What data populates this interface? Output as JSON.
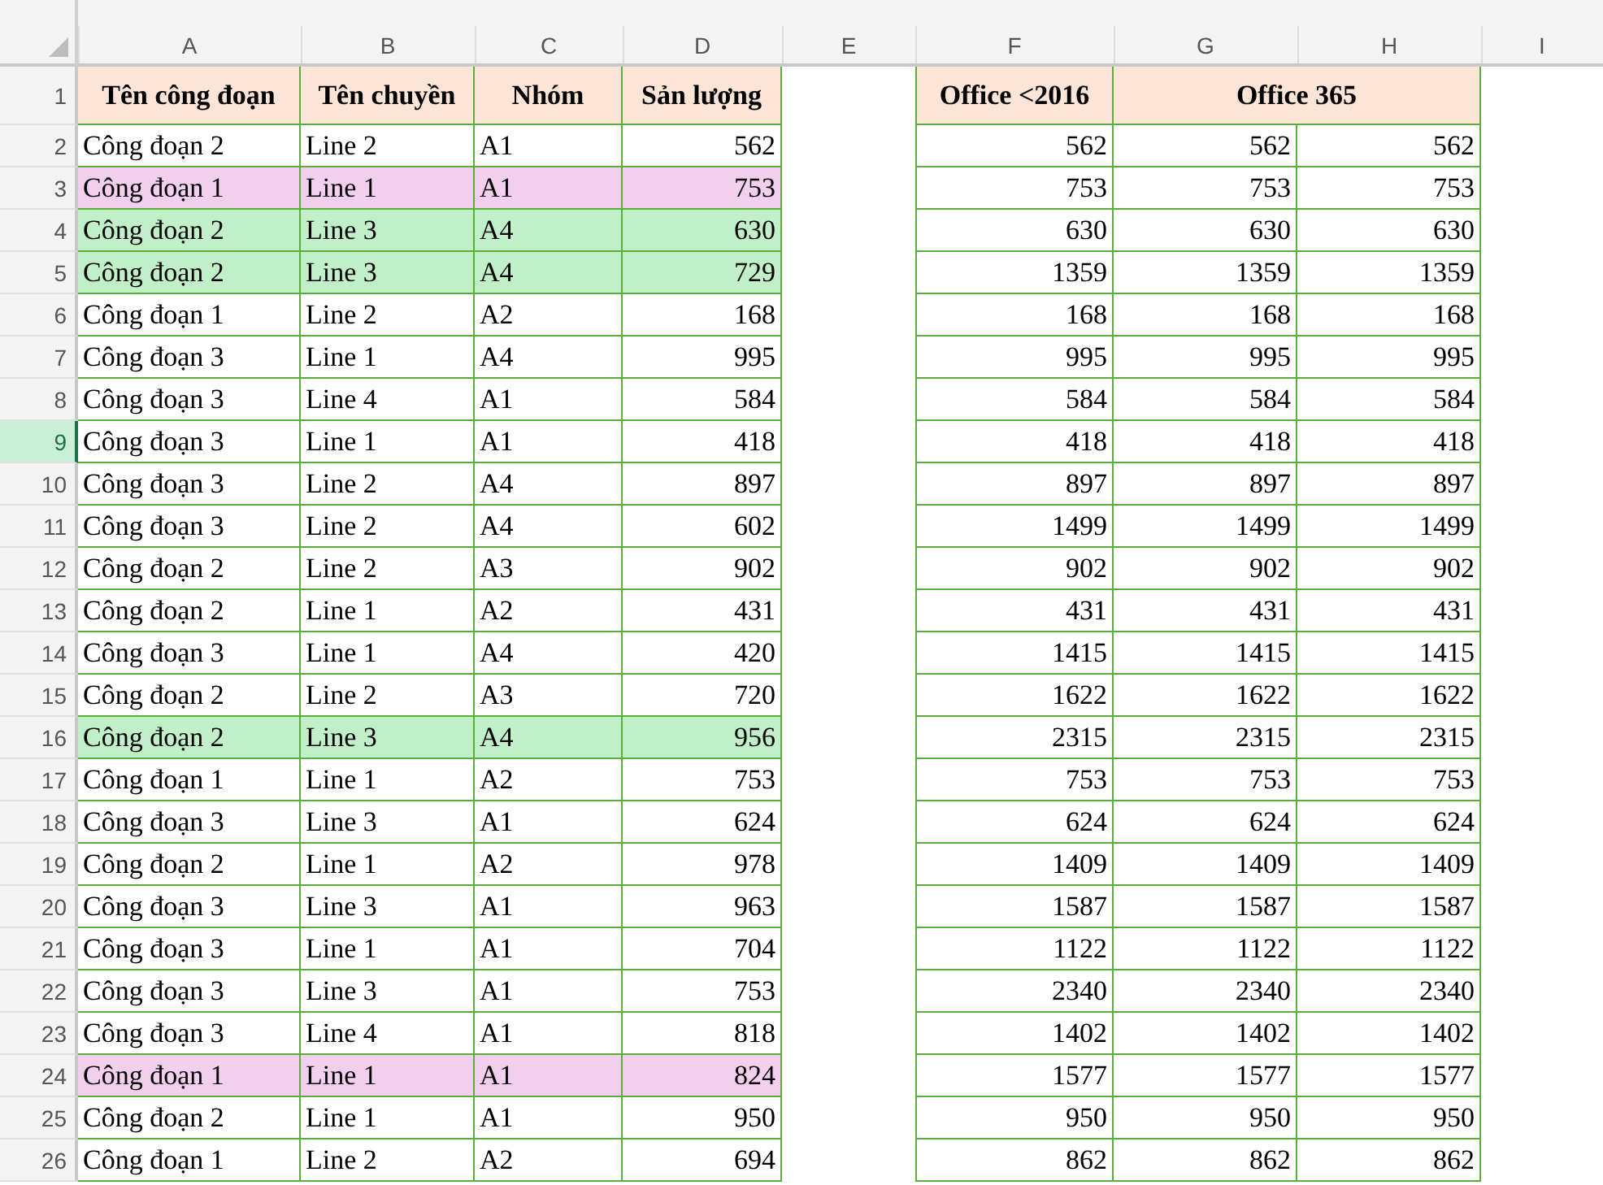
{
  "columns": [
    {
      "letter": "A"
    },
    {
      "letter": "B"
    },
    {
      "letter": "C"
    },
    {
      "letter": "D"
    },
    {
      "letter": "E"
    },
    {
      "letter": "F"
    },
    {
      "letter": "G"
    },
    {
      "letter": "H"
    },
    {
      "letter": "I"
    }
  ],
  "header_row": {
    "number": "1",
    "headers": [
      "Tên công đoạn",
      "Tên chuyền",
      "Nhóm",
      "Sản lượng"
    ],
    "office_old": "Office <2016",
    "office_365": "Office 365"
  },
  "rows": [
    {
      "number": "2",
      "selected": false,
      "color": "#ffffff",
      "cells": [
        "Công đoạn 2",
        "Line 2",
        "A1",
        "562"
      ],
      "results": [
        "562",
        "562",
        "562"
      ]
    },
    {
      "number": "3",
      "selected": false,
      "color": "#f2cfee",
      "cells": [
        "Công đoạn 1",
        "Line 1",
        "A1",
        "753"
      ],
      "results": [
        "753",
        "753",
        "753"
      ]
    },
    {
      "number": "4",
      "selected": false,
      "color": "#c1f0c8",
      "cells": [
        "Công đoạn 2",
        "Line 3",
        "A4",
        "630"
      ],
      "results": [
        "630",
        "630",
        "630"
      ]
    },
    {
      "number": "5",
      "selected": false,
      "color": "#c1f0c8",
      "cells": [
        "Công đoạn 2",
        "Line 3",
        "A4",
        "729"
      ],
      "results": [
        "1359",
        "1359",
        "1359"
      ]
    },
    {
      "number": "6",
      "selected": false,
      "color": "#ffffff",
      "cells": [
        "Công đoạn 1",
        "Line 2",
        "A2",
        "168"
      ],
      "results": [
        "168",
        "168",
        "168"
      ]
    },
    {
      "number": "7",
      "selected": false,
      "color": "#ffffff",
      "cells": [
        "Công đoạn 3",
        "Line 1",
        "A4",
        "995"
      ],
      "results": [
        "995",
        "995",
        "995"
      ]
    },
    {
      "number": "8",
      "selected": false,
      "color": "#ffffff",
      "cells": [
        "Công đoạn 3",
        "Line 4",
        "A1",
        "584"
      ],
      "results": [
        "584",
        "584",
        "584"
      ]
    },
    {
      "number": "9",
      "selected": true,
      "color": "#ffffff",
      "cells": [
        "Công đoạn 3",
        "Line 1",
        "A1",
        "418"
      ],
      "results": [
        "418",
        "418",
        "418"
      ]
    },
    {
      "number": "10",
      "selected": false,
      "color": "#ffffff",
      "cells": [
        "Công đoạn 3",
        "Line 2",
        "A4",
        "897"
      ],
      "results": [
        "897",
        "897",
        "897"
      ]
    },
    {
      "number": "11",
      "selected": false,
      "color": "#ffffff",
      "cells": [
        "Công đoạn 3",
        "Line 2",
        "A4",
        "602"
      ],
      "results": [
        "1499",
        "1499",
        "1499"
      ]
    },
    {
      "number": "12",
      "selected": false,
      "color": "#ffffff",
      "cells": [
        "Công đoạn 2",
        "Line 2",
        "A3",
        "902"
      ],
      "results": [
        "902",
        "902",
        "902"
      ]
    },
    {
      "number": "13",
      "selected": false,
      "color": "#ffffff",
      "cells": [
        "Công đoạn 2",
        "Line 1",
        "A2",
        "431"
      ],
      "results": [
        "431",
        "431",
        "431"
      ]
    },
    {
      "number": "14",
      "selected": false,
      "color": "#ffffff",
      "cells": [
        "Công đoạn 3",
        "Line 1",
        "A4",
        "420"
      ],
      "results": [
        "1415",
        "1415",
        "1415"
      ]
    },
    {
      "number": "15",
      "selected": false,
      "color": "#ffffff",
      "cells": [
        "Công đoạn 2",
        "Line 2",
        "A3",
        "720"
      ],
      "results": [
        "1622",
        "1622",
        "1622"
      ]
    },
    {
      "number": "16",
      "selected": false,
      "color": "#c1f0c8",
      "cells": [
        "Công đoạn 2",
        "Line 3",
        "A4",
        "956"
      ],
      "results": [
        "2315",
        "2315",
        "2315"
      ]
    },
    {
      "number": "17",
      "selected": false,
      "color": "#ffffff",
      "cells": [
        "Công đoạn 1",
        "Line 1",
        "A2",
        "753"
      ],
      "results": [
        "753",
        "753",
        "753"
      ]
    },
    {
      "number": "18",
      "selected": false,
      "color": "#ffffff",
      "cells": [
        "Công đoạn 3",
        "Line 3",
        "A1",
        "624"
      ],
      "results": [
        "624",
        "624",
        "624"
      ]
    },
    {
      "number": "19",
      "selected": false,
      "color": "#ffffff",
      "cells": [
        "Công đoạn 2",
        "Line 1",
        "A2",
        "978"
      ],
      "results": [
        "1409",
        "1409",
        "1409"
      ]
    },
    {
      "number": "20",
      "selected": false,
      "color": "#ffffff",
      "cells": [
        "Công đoạn 3",
        "Line 3",
        "A1",
        "963"
      ],
      "results": [
        "1587",
        "1587",
        "1587"
      ]
    },
    {
      "number": "21",
      "selected": false,
      "color": "#ffffff",
      "cells": [
        "Công đoạn 3",
        "Line 1",
        "A1",
        "704"
      ],
      "results": [
        "1122",
        "1122",
        "1122"
      ]
    },
    {
      "number": "22",
      "selected": false,
      "color": "#ffffff",
      "cells": [
        "Công đoạn 3",
        "Line 3",
        "A1",
        "753"
      ],
      "results": [
        "2340",
        "2340",
        "2340"
      ]
    },
    {
      "number": "23",
      "selected": false,
      "color": "#ffffff",
      "cells": [
        "Công đoạn 3",
        "Line 4",
        "A1",
        "818"
      ],
      "results": [
        "1402",
        "1402",
        "1402"
      ]
    },
    {
      "number": "24",
      "selected": false,
      "color": "#f2cfee",
      "cells": [
        "Công đoạn 1",
        "Line 1",
        "A1",
        "824"
      ],
      "results": [
        "1577",
        "1577",
        "1577"
      ]
    },
    {
      "number": "25",
      "selected": false,
      "color": "#ffffff",
      "cells": [
        "Công đoạn 2",
        "Line 1",
        "A1",
        "950"
      ],
      "results": [
        "950",
        "950",
        "950"
      ]
    },
    {
      "number": "26",
      "selected": false,
      "color": "#ffffff",
      "cells": [
        "Công đoạn 1",
        "Line 2",
        "A2",
        "694"
      ],
      "results": [
        "862",
        "862",
        "862"
      ]
    }
  ]
}
